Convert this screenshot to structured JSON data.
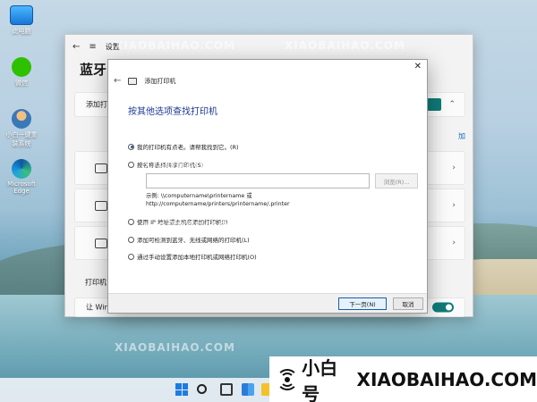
{
  "desktop": {
    "icons": [
      {
        "label": "此电脑",
        "icon": "computer-icon"
      },
      {
        "label": "微信",
        "icon": "wechat-icon"
      },
      {
        "label": "小白一键重装系统",
        "icon": "user-icon"
      },
      {
        "label": "Microsoft Edge",
        "icon": "edge-icon"
      }
    ]
  },
  "watermark": {
    "text": "XIAOBAIHAO.COM",
    "text2": "@小白号"
  },
  "settings": {
    "title": "设置",
    "page_title": "蓝牙",
    "add_row_label": "添加打",
    "add_side_label": "加",
    "section_label": "打印机首",
    "bottom_row_label": "让 Win"
  },
  "dialog": {
    "title": "添加打印机",
    "heading": "按其他选项查找打印机",
    "options": [
      {
        "label": "我的打印机有点老。请帮我找到它。(R)",
        "selected": true
      },
      {
        "label": "按名称选择共享打印机(S)",
        "selected": false
      },
      {
        "label": "使用 IP 地址或主机名添加打印机(I)",
        "selected": false
      },
      {
        "label": "添加可检测到蓝牙、无线或网络的打印机(L)",
        "selected": false
      },
      {
        "label": "通过手动设置添加本地打印机或网络打印机(O)",
        "selected": false
      }
    ],
    "shared_input_value": "",
    "browse_label": "浏览(R)...",
    "example_line1": "示例: \\\\computername\\printername 或",
    "example_line2": "http://computername/printers/printername/.printer",
    "next_label": "下一页(N)",
    "cancel_label": "取消"
  },
  "taskbar": {
    "icons": [
      "start-icon",
      "search-icon",
      "task-view-icon",
      "widgets-icon",
      "file-explorer-icon"
    ]
  },
  "brand": {
    "name_cn": "小白号",
    "name_en": "XIAOBAIHAO.COM"
  }
}
